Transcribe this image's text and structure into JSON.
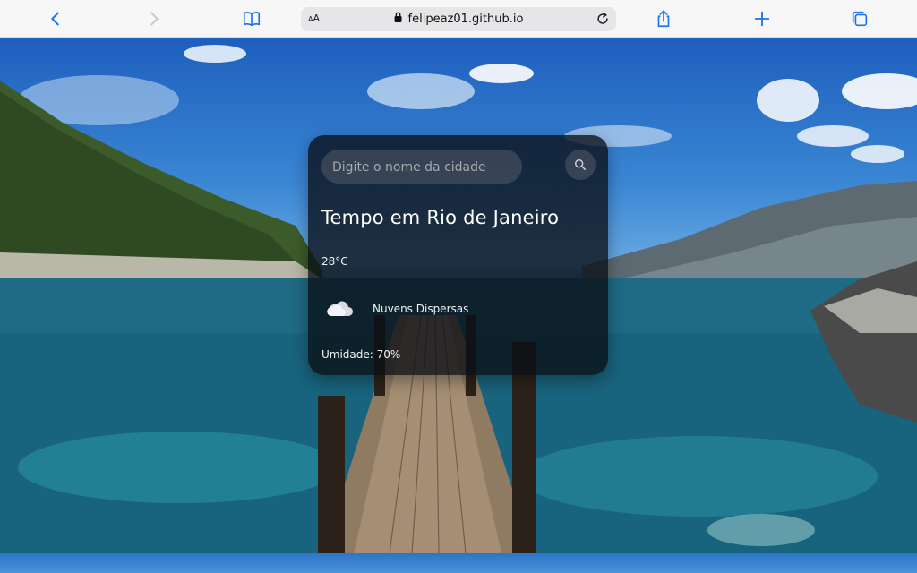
{
  "browser": {
    "url": "felipeaz01.github.io",
    "aa_label": "AA"
  },
  "weather_card": {
    "search_placeholder": "Digite o nome da cidade",
    "title": "Tempo em Rio de Janeiro",
    "temperature": "28°C",
    "condition": "Nuvens Dispersas",
    "humidity": "Umidade: 70%"
  },
  "colors": {
    "accent": "#1a73e8",
    "card_bg": "#0a0e14",
    "toolbar_bg": "#f7f7f8"
  },
  "icons": {
    "back": "chevron-left-icon",
    "forward": "chevron-right-icon",
    "bookmarks": "book-icon",
    "lock": "lock-icon",
    "reload": "reload-icon",
    "share": "share-icon",
    "new_tab": "plus-icon",
    "tabs": "tabs-icon",
    "search": "search-icon",
    "weather": "cloud-icon"
  }
}
